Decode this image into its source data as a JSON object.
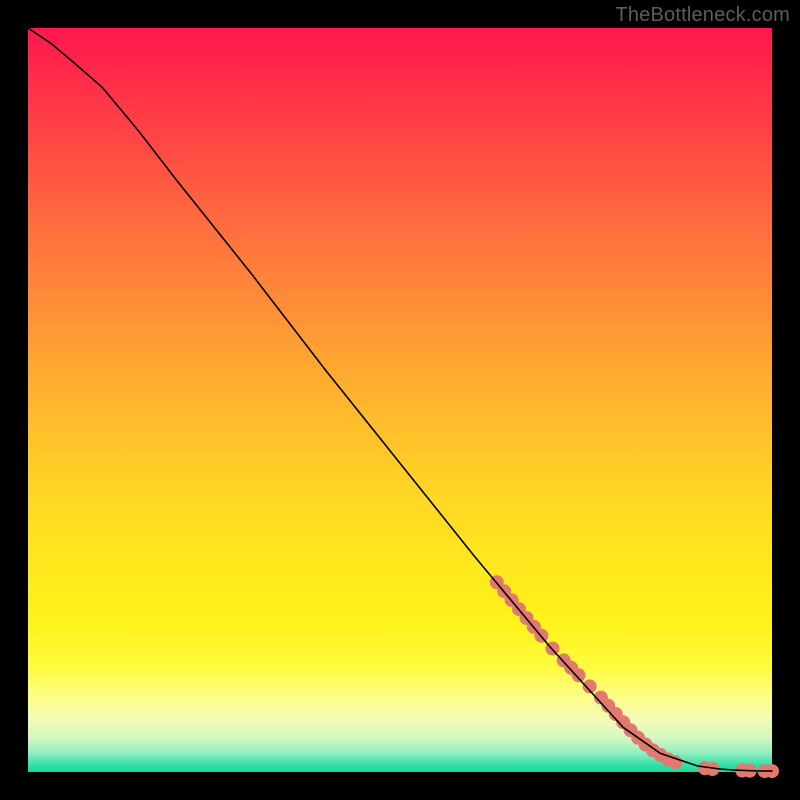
{
  "watermark": "TheBottleneck.com",
  "chart_data": {
    "type": "line",
    "title": "",
    "xlabel": "",
    "ylabel": "",
    "xlim": [
      0,
      100
    ],
    "ylim": [
      0,
      100
    ],
    "grid": false,
    "series": [
      {
        "name": "curve",
        "color": "#000000",
        "x": [
          0,
          3,
          6,
          10,
          15,
          20,
          30,
          40,
          50,
          60,
          70,
          80,
          85,
          90,
          93,
          95,
          97,
          98.5,
          100
        ],
        "y": [
          100,
          98,
          95.5,
          92,
          86,
          79.5,
          67,
          54,
          41.5,
          29,
          17,
          6,
          2.5,
          0.8,
          0.4,
          0.25,
          0.18,
          0.14,
          0.12
        ]
      }
    ],
    "markers": [
      {
        "name": "highlight-segment",
        "color": "#e2796e",
        "radius": 7,
        "points": [
          {
            "x": 63,
            "y": 25.5
          },
          {
            "x": 64,
            "y": 24.3
          },
          {
            "x": 65,
            "y": 23.1
          },
          {
            "x": 66,
            "y": 21.9
          },
          {
            "x": 67,
            "y": 20.7
          },
          {
            "x": 68,
            "y": 19.5
          },
          {
            "x": 69,
            "y": 18.3
          },
          {
            "x": 70.5,
            "y": 16.6
          },
          {
            "x": 72,
            "y": 15.0
          },
          {
            "x": 73,
            "y": 14.0
          },
          {
            "x": 74,
            "y": 13.0
          },
          {
            "x": 75.5,
            "y": 11.5
          },
          {
            "x": 77,
            "y": 10.0
          },
          {
            "x": 78,
            "y": 8.9
          },
          {
            "x": 79,
            "y": 7.8
          },
          {
            "x": 80,
            "y": 6.7
          },
          {
            "x": 81,
            "y": 5.6
          },
          {
            "x": 82,
            "y": 4.6
          },
          {
            "x": 83,
            "y": 3.7
          },
          {
            "x": 84,
            "y": 2.9
          },
          {
            "x": 85,
            "y": 2.3
          },
          {
            "x": 86,
            "y": 1.7
          },
          {
            "x": 87,
            "y": 1.3
          },
          {
            "x": 91,
            "y": 0.5
          },
          {
            "x": 92,
            "y": 0.4
          },
          {
            "x": 96,
            "y": 0.2
          },
          {
            "x": 97,
            "y": 0.18
          },
          {
            "x": 99,
            "y": 0.14
          },
          {
            "x": 100,
            "y": 0.12
          }
        ]
      }
    ]
  }
}
